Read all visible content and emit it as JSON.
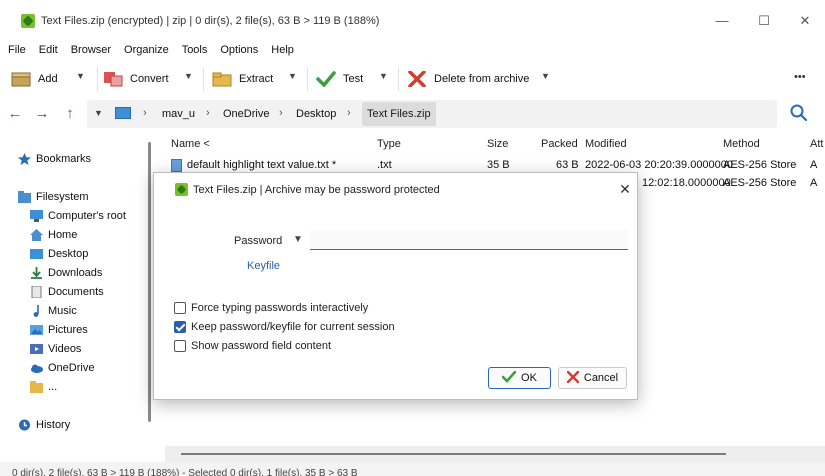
{
  "window": {
    "title": "Text Files.zip (encrypted) | zip | 0 dir(s), 2 file(s), 63 B > 119 B (188%)",
    "controls": {
      "minimize": "—",
      "maximize": "☐",
      "close": "✕"
    }
  },
  "menu": [
    "File",
    "Edit",
    "Browser",
    "Organize",
    "Tools",
    "Options",
    "Help"
  ],
  "toolbar": {
    "add": "Add",
    "convert": "Convert",
    "extract": "Extract",
    "test": "Test",
    "delete": "Delete from archive",
    "more": "•••"
  },
  "address": {
    "crumbs": [
      "mav_u",
      "OneDrive",
      "Desktop"
    ],
    "current": "Text Files.zip"
  },
  "sidebar": {
    "bookmarks": "Bookmarks",
    "filesystem": "Filesystem",
    "items": [
      "Computer's root",
      "Home",
      "Desktop",
      "Downloads",
      "Documents",
      "Music",
      "Pictures",
      "Videos",
      "OneDrive",
      "..."
    ],
    "history": "History"
  },
  "filelist": {
    "columns": {
      "name": "Name <",
      "type": "Type",
      "size": "Size",
      "packed": "Packed",
      "modified": "Modified",
      "method": "Method",
      "attr": "Att"
    },
    "rows": [
      {
        "name": "default highlight text value.txt *",
        "type": ".txt",
        "size": "35 B",
        "packed": "63 B",
        "modified": "2022-06-03 20:20:39.0000000",
        "method": "AES-256 Store",
        "attr": "A"
      },
      {
        "name": "",
        "type": "",
        "size": "",
        "packed": "",
        "modified": "12:02:18.0000000",
        "method": "AES-256 Store",
        "attr": "A"
      }
    ]
  },
  "status": "0 dir(s), 2 file(s), 63 B > 119 B (188%) - Selected 0 dir(s), 1 file(s), 35 B > 63 B",
  "dialog": {
    "title": "Text Files.zip | Archive may be password protected",
    "password_label": "Password",
    "password_value": "",
    "keyfile": "Keyfile",
    "options": [
      {
        "label": "Force typing passwords interactively",
        "checked": false
      },
      {
        "label": "Keep password/keyfile for current session",
        "checked": true
      },
      {
        "label": "Show password field content",
        "checked": false
      }
    ],
    "ok": "OK",
    "cancel": "Cancel"
  },
  "colors": {
    "accent": "#2a6bb5",
    "ok_green": "#3aa03a",
    "cancel_red": "#d23c2c"
  }
}
